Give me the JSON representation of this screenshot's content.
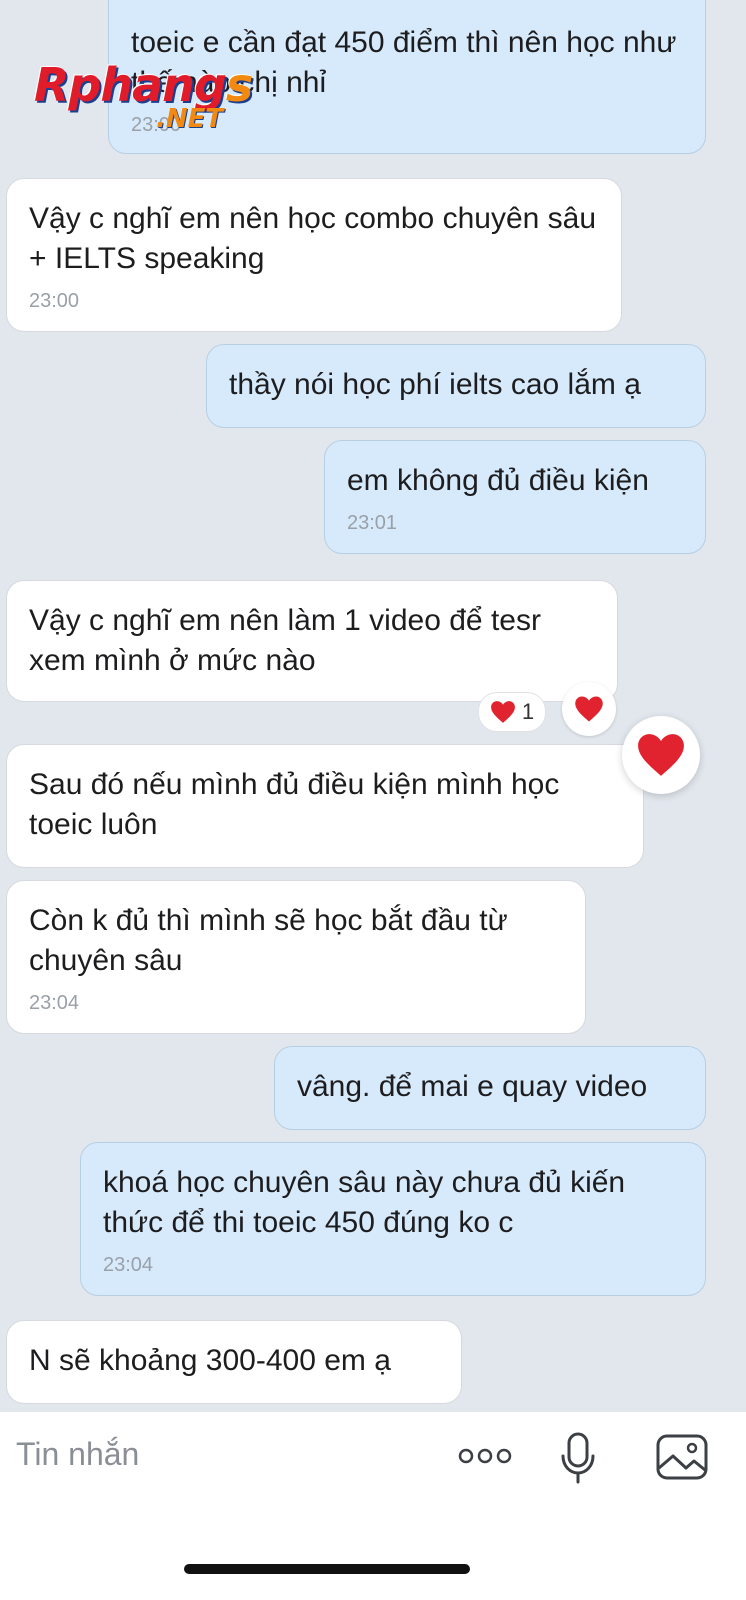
{
  "watermark": {
    "brand": "Rphang",
    "brand_tail": "s",
    "suffix": ".NET"
  },
  "messages": [
    {
      "side": "out",
      "text": "toeic e cần đạt 450 điểm thì nên học như thế nào chị nhỉ",
      "time": "23:00"
    },
    {
      "side": "in",
      "text": "Vậy c nghĩ em nên học combo chuyên sâu + IELTS speaking",
      "time": "23:00"
    },
    {
      "side": "out",
      "text": "thầy nói học phí ielts cao lắm ạ",
      "time": ""
    },
    {
      "side": "out",
      "text": "em không đủ điều kiện",
      "time": "23:01"
    },
    {
      "side": "in",
      "text": "Vậy c nghĩ em nên làm 1 video để tesr xem mình ở mức nào",
      "time": ""
    },
    {
      "side": "in",
      "text": "Sau đó nếu mình đủ điều kiện mình học toeic luôn",
      "time": ""
    },
    {
      "side": "in",
      "text": "Còn k đủ thì mình sẽ học bắt đầu từ chuyên sâu",
      "time": "23:04"
    },
    {
      "side": "out",
      "text": "vâng. để mai e quay video",
      "time": ""
    },
    {
      "side": "out",
      "text": "khoá học chuyên sâu này chưa đủ kiến thức để thi toeic 450 đúng ko c",
      "time": "23:04"
    },
    {
      "side": "in",
      "text": "N sẽ khoảng 300-400 em ạ",
      "time": ""
    }
  ],
  "reaction": {
    "count": "1",
    "color": "#e0232e"
  },
  "input": {
    "placeholder": "Tin nhắn"
  },
  "icons": {
    "more": "more-dots-icon",
    "mic": "microphone-icon",
    "image": "image-icon",
    "heart": "heart-icon"
  }
}
